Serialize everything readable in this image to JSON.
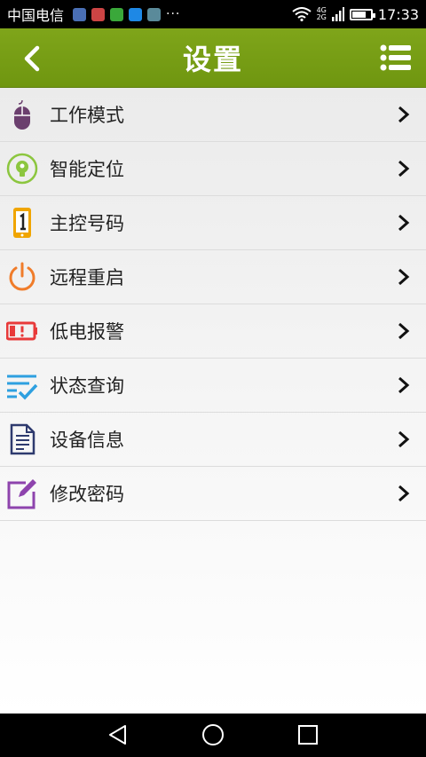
{
  "status_bar": {
    "carrier": "中国电信",
    "more": "···",
    "network_top": "4G",
    "network_bottom": "2G",
    "time": "17:33",
    "battery_level": 0.75
  },
  "header": {
    "title": "设置",
    "back_icon": "chevron-left-icon",
    "menu_icon": "list-icon"
  },
  "menu": {
    "items": [
      {
        "label": "工作模式",
        "icon": "mouse-icon",
        "color": "#6b3f6e"
      },
      {
        "label": "智能定位",
        "icon": "location-bulb-icon",
        "color": "#8cc63f"
      },
      {
        "label": "主控号码",
        "icon": "phone-number-icon",
        "color": "#f0a500"
      },
      {
        "label": "远程重启",
        "icon": "power-icon",
        "color": "#f07c2a"
      },
      {
        "label": "低电报警",
        "icon": "low-battery-icon",
        "color": "#e83a3a"
      },
      {
        "label": "状态查询",
        "icon": "checklist-icon",
        "color": "#2ea0e0"
      },
      {
        "label": "设备信息",
        "icon": "document-icon",
        "color": "#2e3a6e"
      },
      {
        "label": "修改密码",
        "icon": "edit-icon",
        "color": "#8e44ad"
      }
    ],
    "chevron_icon": "chevron-right-icon"
  },
  "nav_bar": {
    "back_icon": "nav-back-icon",
    "home_icon": "nav-home-icon",
    "recents_icon": "nav-recents-icon"
  },
  "colors": {
    "accent": "#76a015",
    "status_bar": "#000000"
  }
}
